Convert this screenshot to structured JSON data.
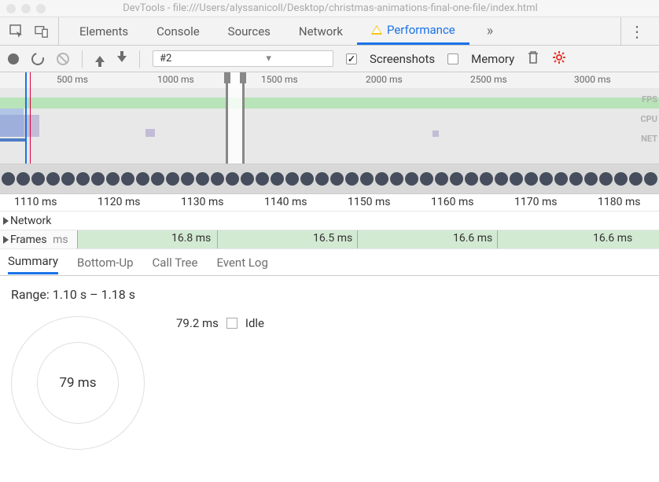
{
  "titlebar": {
    "title": "DevTools - file:///Users/alyssanicoll/Desktop/christmas-animations-final-one-file/index.html"
  },
  "tabs": {
    "elements": "Elements",
    "console": "Console",
    "sources": "Sources",
    "network": "Network",
    "performance": "Performance",
    "more": "»",
    "menu": "⋮"
  },
  "toolbar": {
    "recording": "#2",
    "screenshots": "Screenshots",
    "memory": "Memory"
  },
  "overview": {
    "ticks": [
      "500 ms",
      "1000 ms",
      "1500 ms",
      "2000 ms",
      "2500 ms",
      "3000 ms"
    ],
    "labels": {
      "fps": "FPS",
      "cpu": "CPU",
      "net": "NET"
    }
  },
  "detail": {
    "ticks": [
      "1110 ms",
      "1120 ms",
      "1130 ms",
      "1140 ms",
      "1150 ms",
      "1160 ms",
      "1170 ms",
      "1180 ms"
    ],
    "network": "Network",
    "frames_label": "Frames",
    "frames_extra": "ms",
    "frames": [
      "16.8 ms",
      "16.5 ms",
      "16.6 ms",
      "16.6 ms"
    ]
  },
  "bottom_tabs": {
    "summary": "Summary",
    "bottom_up": "Bottom-Up",
    "call_tree": "Call Tree",
    "event_log": "Event Log"
  },
  "summary": {
    "range": "Range: 1.10 s – 1.18 s",
    "donut": "79 ms",
    "legend_val": "79.2 ms",
    "legend_label": "Idle"
  }
}
